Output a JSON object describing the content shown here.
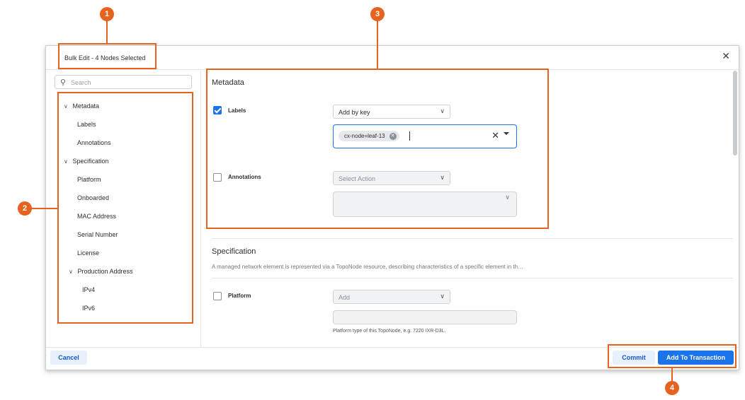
{
  "callouts": [
    "1",
    "2",
    "3",
    "4"
  ],
  "dialog": {
    "title": "Bulk Edit - 4 Nodes Selected",
    "close_icon": "close-icon"
  },
  "search": {
    "placeholder": "Search"
  },
  "nav": {
    "items": [
      {
        "label": "Metadata",
        "expanded": true
      },
      {
        "label": "Labels"
      },
      {
        "label": "Annotations"
      },
      {
        "label": "Specification",
        "expanded": true
      },
      {
        "label": "Platform"
      },
      {
        "label": "Onboarded"
      },
      {
        "label": "MAC Address"
      },
      {
        "label": "Serial Number"
      },
      {
        "label": "License"
      },
      {
        "label": "Production Address",
        "expanded": true
      },
      {
        "label": "IPv4"
      },
      {
        "label": "IPv6"
      }
    ]
  },
  "metadata": {
    "title": "Metadata",
    "labels": {
      "label": "Labels",
      "checked": true,
      "action": "Add by key",
      "chip": "cx-node=leaf-13"
    },
    "annotations": {
      "label": "Annotations",
      "checked": false,
      "action_placeholder": "Select Action"
    }
  },
  "specification": {
    "title": "Specification",
    "description": "A managed network element is represented via a TopoNode resource, describing characteristics of a specific element in th…",
    "platform": {
      "label": "Platform",
      "checked": false,
      "action": "Add",
      "helper": "Platform type of this TopoNode, e.g. 7220 IXR-D3L."
    }
  },
  "footer": {
    "cancel": "Cancel",
    "commit": "Commit",
    "add_to_transaction": "Add To Transaction"
  },
  "colors": {
    "accent": "#e8621f",
    "primary": "#1a73e8"
  }
}
